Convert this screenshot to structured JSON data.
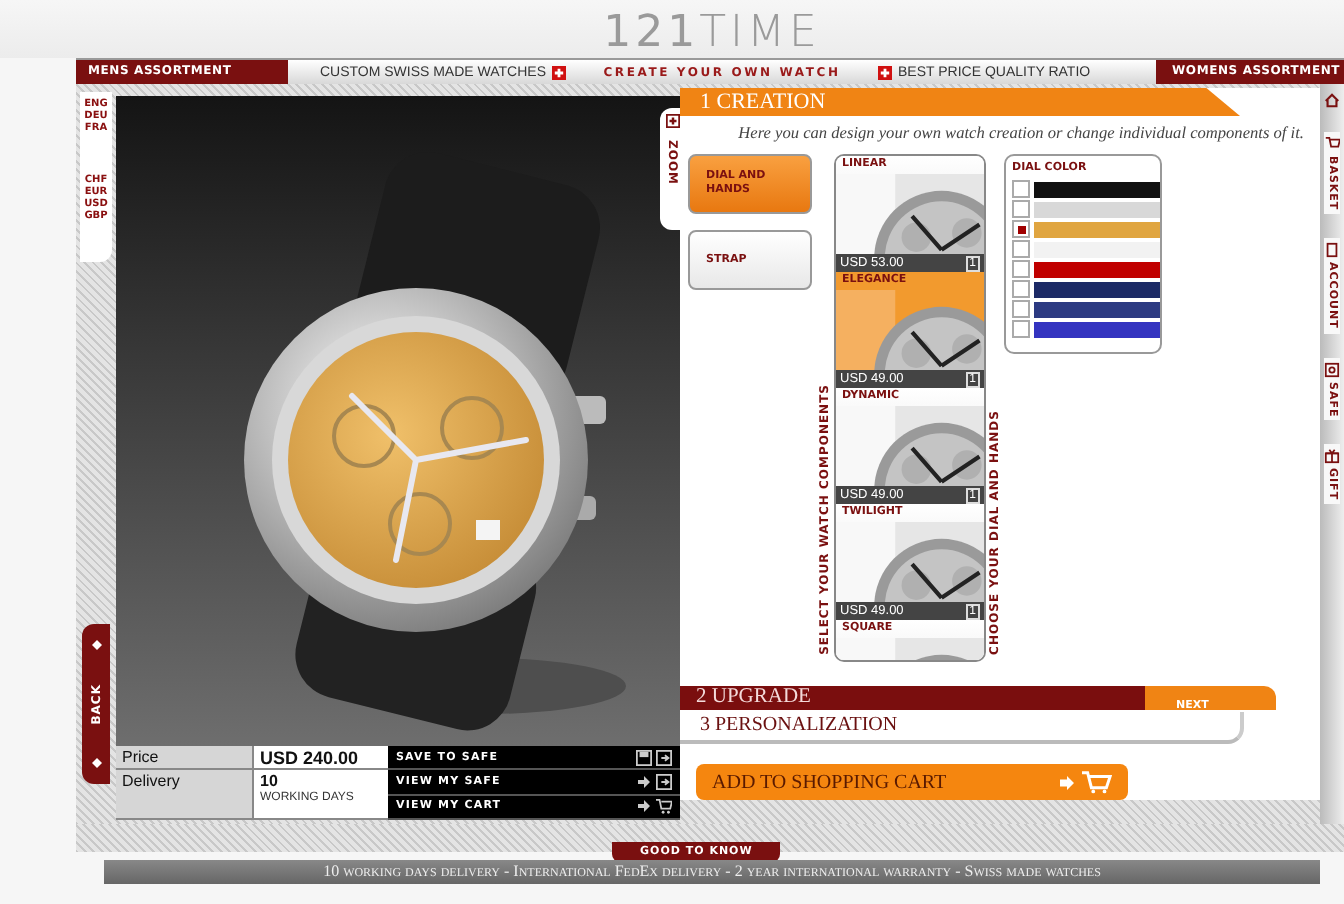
{
  "header": {
    "logo": "**121**TIME",
    "tagline": "CREATE YOUR OWN WATCH",
    "tabs": [
      {
        "label": "MENS ASSORTMENT",
        "kind": "assortment"
      },
      {
        "label": "CUSTOM SWISS MADE WATCHES",
        "kind": "claim"
      },
      {
        "label": "BEST PRICE QUALITY RATIO",
        "kind": "claim"
      },
      {
        "label": "WOMENS ASSORTMENT",
        "kind": "assortment"
      }
    ]
  },
  "languages": [
    "ENG",
    "DEU",
    "FRA"
  ],
  "currencies": [
    "CHF",
    "EUR",
    "USD",
    "GBP"
  ],
  "back": "BACK",
  "zoom": "ZOOM",
  "summary": {
    "price_label": "Price",
    "price": "USD 240.00",
    "delivery_label": "Delivery",
    "delivery": "10",
    "delivery_unit": "WORKING DAYS"
  },
  "actions": [
    {
      "label": "SAVE TO SAFE",
      "kind": "save"
    },
    {
      "label": "VIEW MY SAFE",
      "kind": "safe"
    },
    {
      "label": "VIEW MY CART",
      "kind": "cart"
    }
  ],
  "creation": {
    "title": "1 CREATION",
    "intro": "Here you can design your own watch creation or change individual components of it.",
    "categories": [
      {
        "label": "DIAL AND HANDS",
        "selected": true
      },
      {
        "label": "STRAP",
        "selected": false
      }
    ],
    "components_label": "SELECT YOUR WATCH COMPONENTS",
    "components": [
      {
        "name": "LINEAR",
        "price": "USD 53.00",
        "count": "1",
        "selected": false
      },
      {
        "name": "ELEGANCE",
        "price": "USD 49.00",
        "count": "1",
        "selected": true
      },
      {
        "name": "DYNAMIC",
        "price": "USD 49.00",
        "count": "1",
        "selected": false
      },
      {
        "name": "TWILIGHT",
        "price": "USD 49.00",
        "count": "1",
        "selected": false
      },
      {
        "name": "SQUARE",
        "selected": false
      }
    ],
    "dial_label": "CHOOSE YOUR DIAL AND HANDS",
    "dial_color": {
      "title": "DIAL COLOR",
      "swatches": [
        {
          "color": "#111111",
          "selected": false
        },
        {
          "color": "#d8d8d8",
          "selected": false
        },
        {
          "color": "#e0a540",
          "selected": true
        },
        {
          "color": "#f2f2f2",
          "selected": false
        },
        {
          "color": "#c00000",
          "selected": false
        },
        {
          "color": "#1c2a66",
          "selected": false
        },
        {
          "color": "#2c3a82",
          "selected": false
        },
        {
          "color": "#3434c0",
          "selected": false
        }
      ]
    }
  },
  "upgrade": {
    "title": "2 UPGRADE",
    "next": "NEXT"
  },
  "personalization": {
    "title": "3 PERSONALIZATION"
  },
  "cart_button": "ADD TO SHOPPING CART",
  "good_to_know": "GOOD TO KNOW",
  "side_tabs": [
    {
      "label": "BASKET",
      "kind": "basket"
    },
    {
      "label": "ACCOUNT",
      "kind": "account"
    },
    {
      "label": "SAFE",
      "kind": "safe"
    },
    {
      "label": "GIFT",
      "kind": "gift"
    }
  ],
  "footer": "10 working days delivery - International FedEx delivery - 2 year international warranty - Swiss made watches"
}
